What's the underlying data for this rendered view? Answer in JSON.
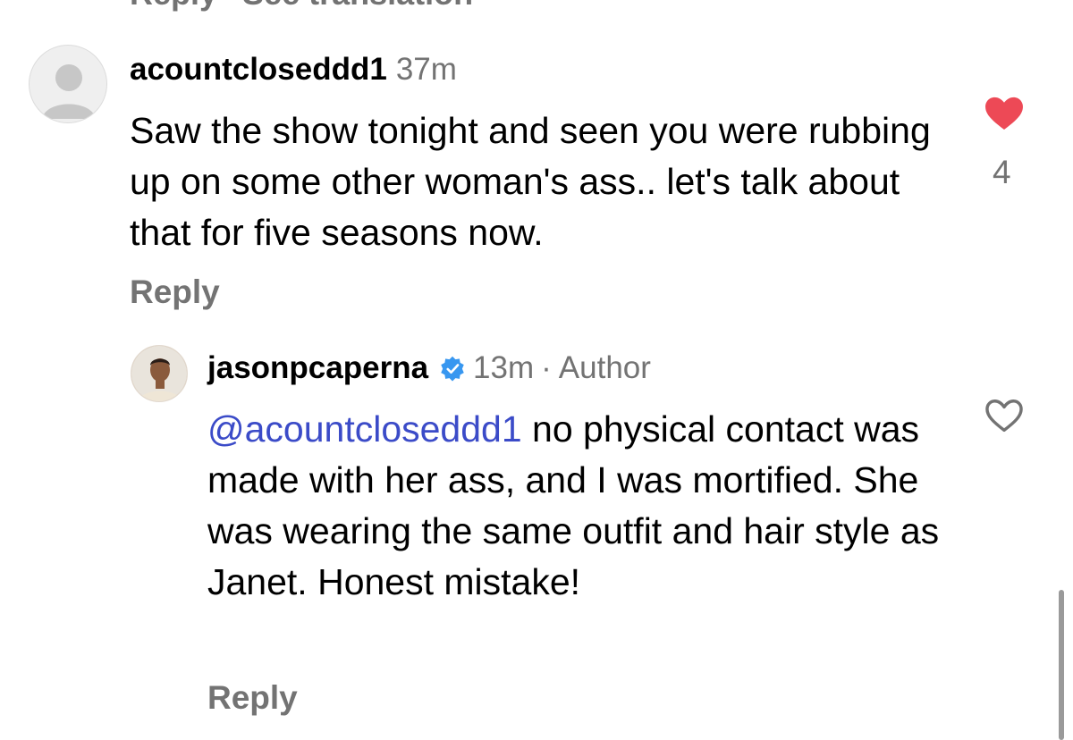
{
  "top_partial": {
    "reply_label": "Reply",
    "translation_label": "See translation"
  },
  "comment1": {
    "username": "acountcloseddd1",
    "time": "37m",
    "text": "Saw the show tonight and seen you were rubbing up on some other woman's ass.. let's talk about that for five seasons now.",
    "reply_label": "Reply",
    "like_count": "4",
    "liked": true,
    "heart_color": "#ed4956"
  },
  "comment2": {
    "username": "jasonpcaperna",
    "verified": true,
    "time": "13m",
    "separator": "·",
    "author_label": "Author",
    "mention": "@acountcloseddd1",
    "text": " no physical contact was made with her ass, and I was mortified. She was wearing the same outfit and hair style as Janet. Honest mistake!",
    "reply_label": "Reply",
    "liked": false
  },
  "colors": {
    "mention": "#3b4bc8",
    "secondary_text": "#737373",
    "verified_badge": "#3897f0"
  }
}
